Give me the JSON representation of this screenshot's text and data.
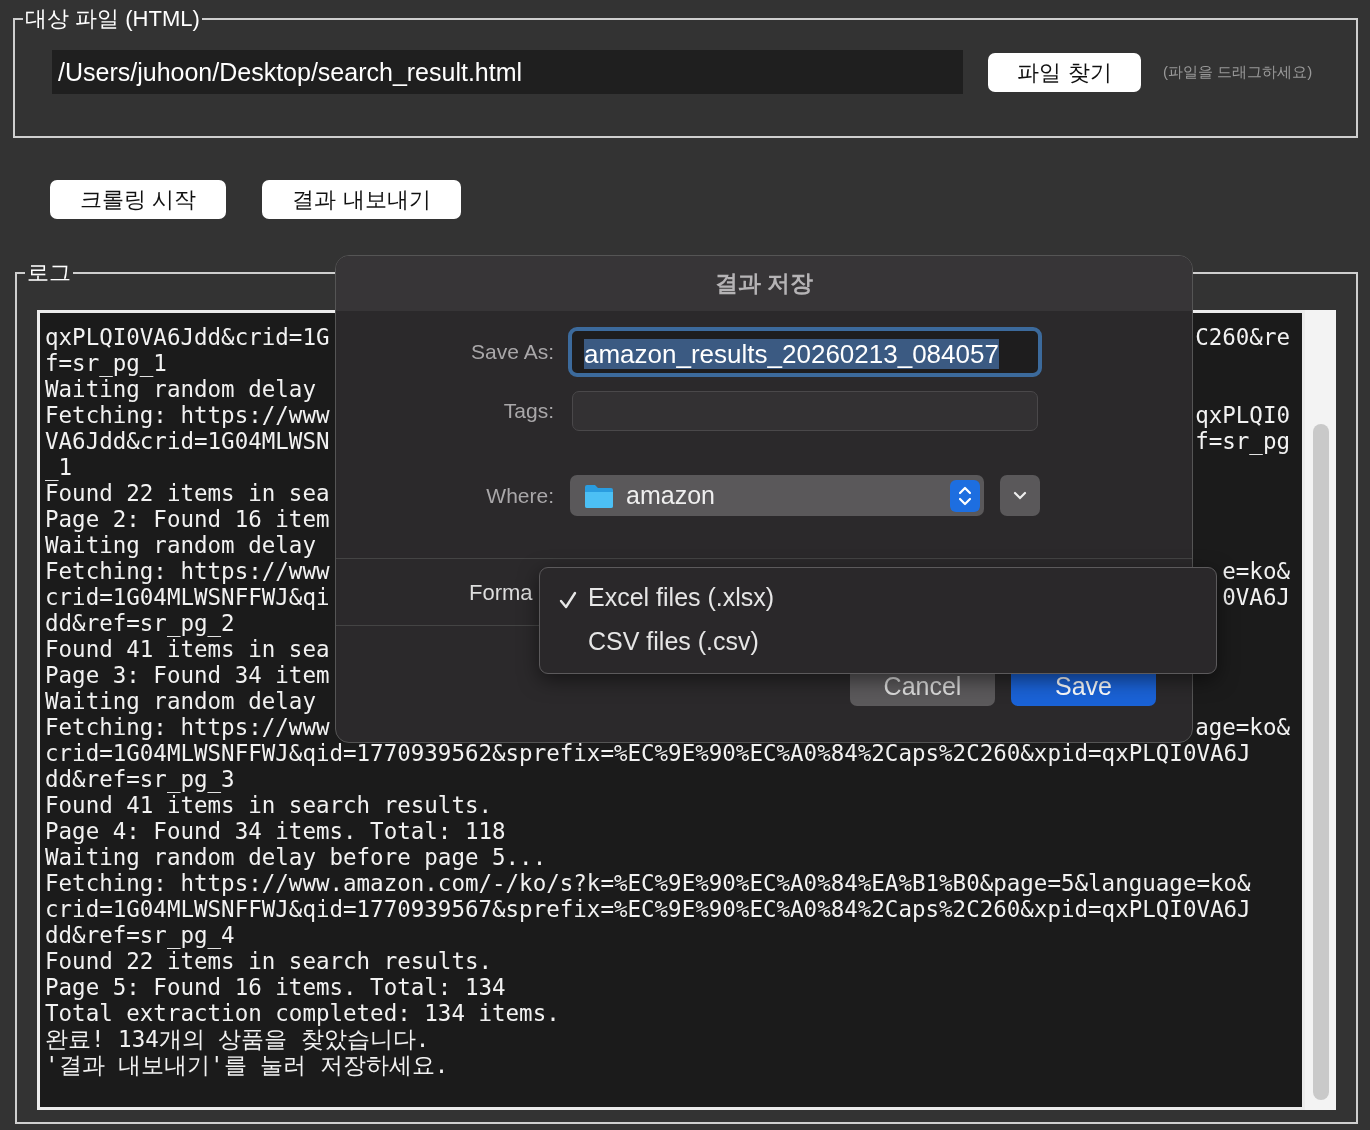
{
  "file_section": {
    "legend": "대상 파일 (HTML)",
    "path": "/Users/juhoon/Desktop/search_result.html",
    "browse_button": "파일 찾기",
    "hint": "(파일을 드래그하세요)"
  },
  "actions": [
    "크롤링 시작",
    "결과 내보내기"
  ],
  "log": {
    "legend": "로그",
    "lines": [
      {
        "text": "qxPLQI0VA6Jdd&crid=1G",
        "text_right": "C260&re"
      },
      {
        "text": "f=sr_pg_1"
      },
      {
        "text": "Waiting random delay"
      },
      {
        "text": "Fetching: https://www",
        "text_right": "qxPLQI0"
      },
      {
        "text": "VA6Jdd&crid=1G04MLWSN",
        "text_right": "f=sr_pg"
      },
      {
        "text": "_1"
      },
      {
        "text": "Found 22 items in sea"
      },
      {
        "text": "Page 2: Found 16 item"
      },
      {
        "text": "Waiting random delay"
      },
      {
        "text": "Fetching: https://www",
        "text_right": "e=ko&"
      },
      {
        "text": "crid=1G04MLWSNFFWJ&qi",
        "text_right": "0VA6J"
      },
      {
        "text": "dd&ref=sr_pg_2"
      },
      {
        "text": "Found 41 items in sea"
      },
      {
        "text": "Page 3: Found 34 item"
      },
      {
        "text": "Waiting random delay"
      },
      {
        "text": "Fetching: https://www",
        "text_right": "age=ko&"
      },
      {
        "text": "crid=1G04MLWSNFFWJ&qid=1770939562&sprefix=%EC%9E%90%EC%A0%84%2Caps%2C260&xpid=qxPLQI0VA6J"
      },
      {
        "text": "dd&ref=sr_pg_3"
      },
      {
        "text": "Found 41 items in search results."
      },
      {
        "text": "Page 4: Found 34 items. Total: 118"
      },
      {
        "text": "Waiting random delay before page 5..."
      },
      {
        "text": "Fetching: https://www.amazon.com/-/ko/s?k=%EC%9E%90%EC%A0%84%EA%B1%B0&page=5&language=ko&"
      },
      {
        "text": "crid=1G04MLWSNFFWJ&qid=1770939567&sprefix=%EC%9E%90%EC%A0%84%2Caps%2C260&xpid=qxPLQI0VA6J"
      },
      {
        "text": "dd&ref=sr_pg_4"
      },
      {
        "text": "Found 22 items in search results."
      },
      {
        "text": "Page 5: Found 16 items. Total: 134"
      },
      {
        "text": "Total extraction completed: 134 items."
      },
      {
        "text": "완료! 134개의 상품을 찾았습니다."
      },
      {
        "text": "'결과 내보내기'를 눌러 저장하세요."
      }
    ]
  },
  "save_dialog": {
    "title": "결과 저장",
    "save_as_label": "Save As:",
    "filename": "amazon_results_20260213_084057",
    "tags_label": "Tags:",
    "where_label": "Where:",
    "where_value": "amazon",
    "format_label": "Forma",
    "format_menu": [
      {
        "label": "Excel files (.xlsx)",
        "selected": true
      },
      {
        "label": "CSV files (.csv)",
        "selected": false
      }
    ],
    "buttons": [
      {
        "label": "Cancel",
        "kind": "secondary"
      },
      {
        "label": "Save",
        "kind": "primary"
      }
    ]
  }
}
